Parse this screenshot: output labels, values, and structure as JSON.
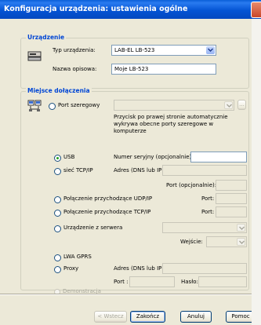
{
  "window": {
    "title": "Konfiguracja urządzenia: ustawienia ogólne"
  },
  "device": {
    "legend": "Urządzenie",
    "type_label": "Typ urządzenia:",
    "type_value": "LAB-EL LB-523",
    "name_label": "Nazwa opisowa:",
    "name_value": "Moje LB-523"
  },
  "connection": {
    "legend": "Miejsce dołączenia",
    "serial_label": "Port szeregowy",
    "serial_browse": "...",
    "serial_note": "Przycisk po prawej stronie automatycznie wykrywa obecne porty szeregowe w komputerze",
    "usb_label": "USB",
    "usb_serial_label": "Numer seryjny (opcjonalnie):",
    "tcp_label": "sieć TCP/IP",
    "tcp_address_label": "Adres (DNS lub IP):",
    "tcp_port_label": "Port (opcjonalnie):",
    "udp_in_label": "Połączenie przychodzące UDP/IP",
    "udp_port_label": "Port:",
    "tcp_in_label": "Połączenie przychodzące TCP/IP",
    "tcp_in_port_label": "Port:",
    "server_label": "Urządzenie z serwera",
    "server_input_label": "Wejście:",
    "gprs_label": "LWA GPRS",
    "proxy_label": "Proxy",
    "proxy_address_label": "Adres (DNS lub IP):",
    "proxy_port_label": "Port :",
    "proxy_password_label": "Hasło:",
    "demo_label": "Demonstracja"
  },
  "buttons": {
    "back": "< Wstecz",
    "finish": "Zakończ",
    "cancel": "Anuluj",
    "help": "Pomoc"
  },
  "colors": {
    "titlebar": "#0454d4",
    "legend": "#0046d5",
    "window_bg": "#ece9d8"
  }
}
